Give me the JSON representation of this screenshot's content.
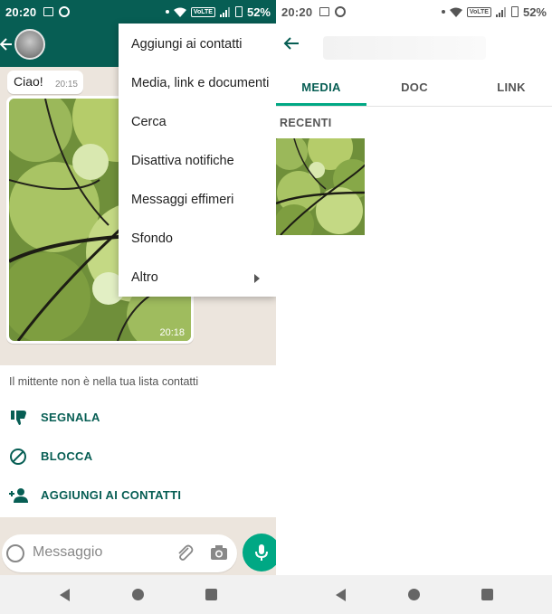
{
  "left": {
    "status": {
      "time": "20:20",
      "battery": "52%",
      "volte": "VoLTE"
    },
    "chat": {
      "text_message": "Ciao!",
      "text_time": "20:15",
      "image_time": "20:18"
    },
    "menu": {
      "items": [
        "Aggiungi ai contatti",
        "Media, link e documenti",
        "Cerca",
        "Disattiva notifiche",
        "Messaggi effimeri",
        "Sfondo",
        "Altro"
      ]
    },
    "unknown_sender": {
      "info": "Il mittente non è nella tua lista contatti",
      "report": "SEGNALA",
      "block": "BLOCCA",
      "add_contact": "AGGIUNGI AI CONTATTI"
    },
    "input": {
      "placeholder": "Messaggio"
    }
  },
  "right": {
    "status": {
      "time": "20:20",
      "battery": "52%",
      "volte": "VoLTE"
    },
    "tabs": [
      "MEDIA",
      "DOC",
      "LINK"
    ],
    "active_tab": "MEDIA",
    "section": "RECENTI"
  },
  "colors": {
    "whatsapp_dark": "#075e54",
    "accent": "#00a884",
    "chat_bg": "#ece5dd"
  }
}
